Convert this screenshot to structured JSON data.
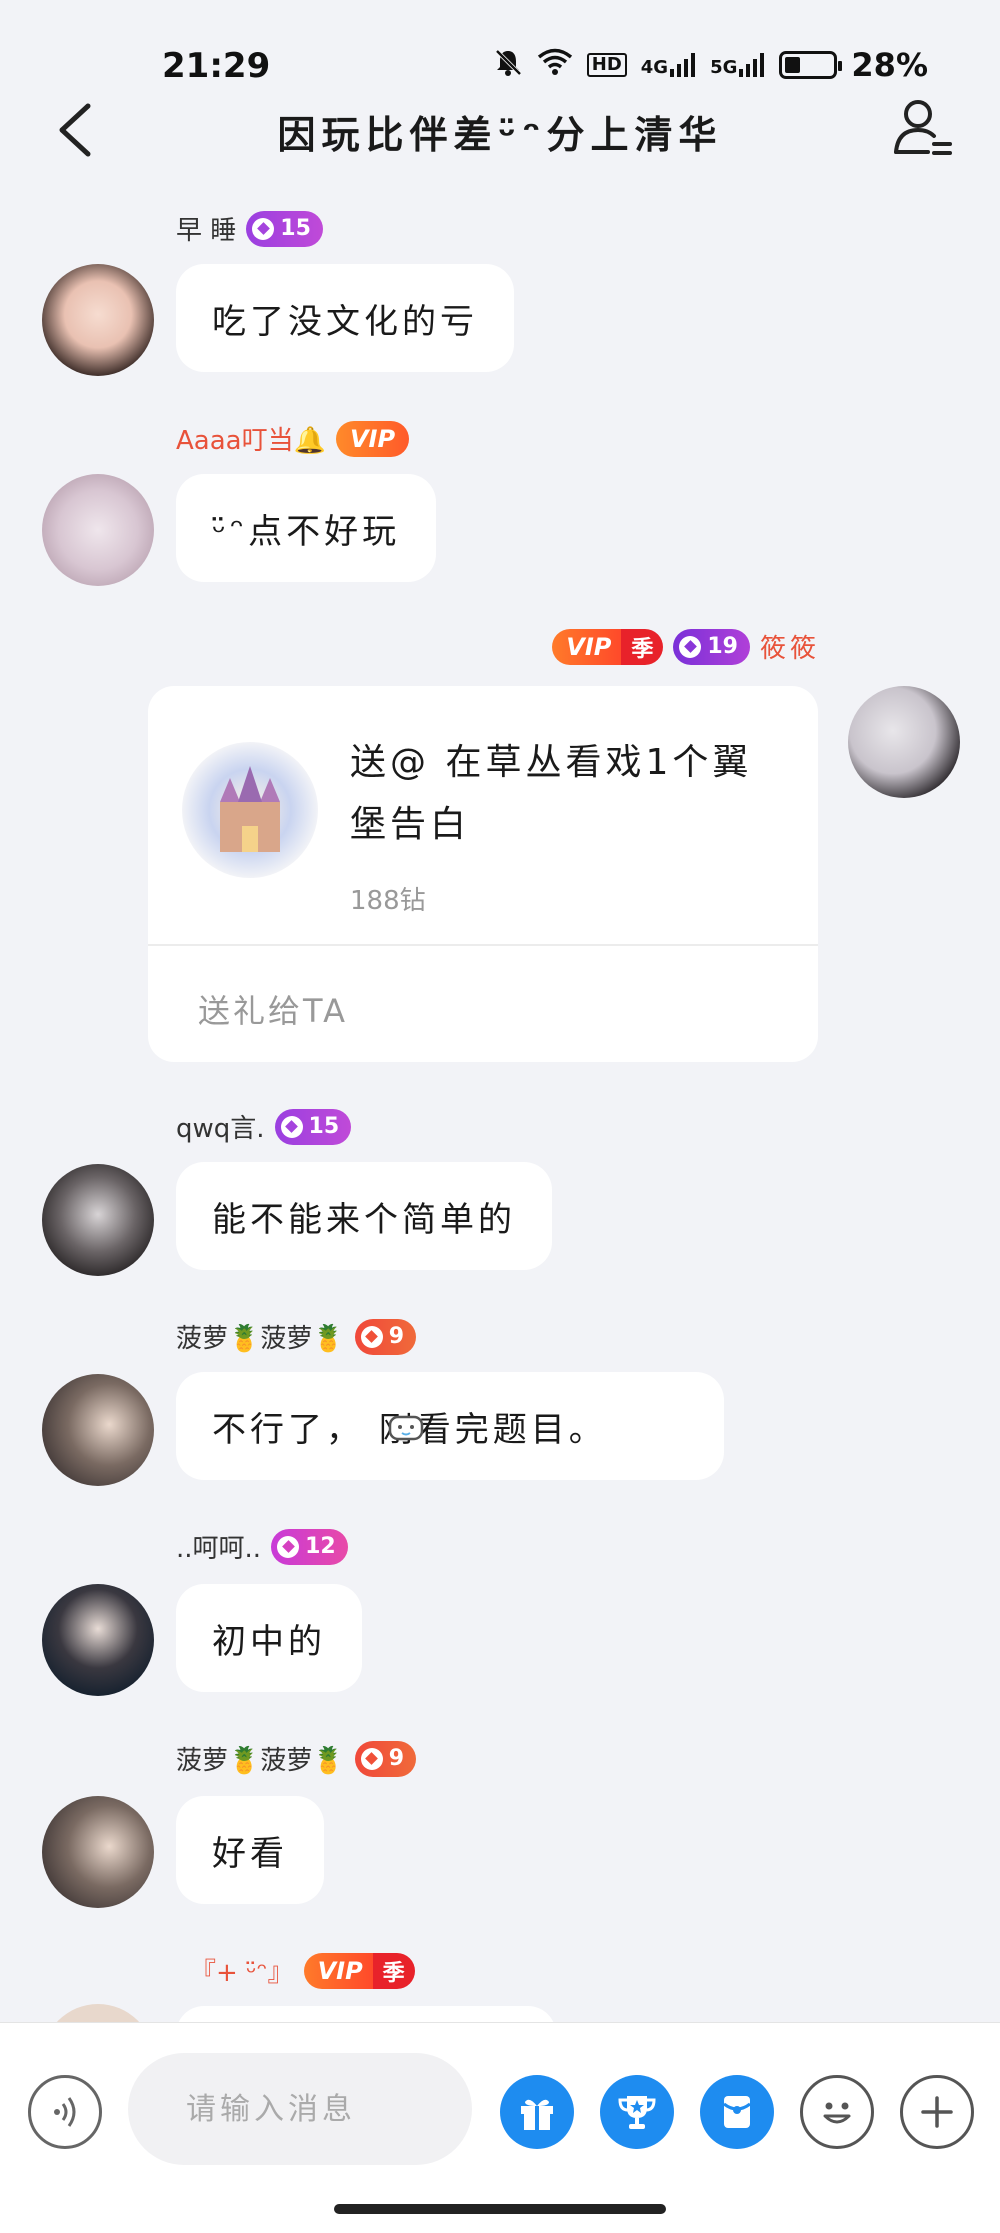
{
  "status_bar": {
    "time": "21:29",
    "network_hd": "HD",
    "network_4g": "4G",
    "network_5g": "5G",
    "battery_level": 0.28,
    "battery": "28%"
  },
  "header": {
    "title": "因玩比伴差ᵕ̈ᵔ分上清华"
  },
  "messages": [
    {
      "sender": "早 睡",
      "level": "15",
      "text": "吃了没文化的亏"
    },
    {
      "sender": "Aaaa叮当🔔",
      "badge": "VIP",
      "text": "ᵕ̈ᵔ点不好玩"
    },
    {
      "sender": "qwq言.",
      "level": "15",
      "text": "能不能来个简单的"
    },
    {
      "sender": "菠萝🍍菠萝🍍",
      "level": "9",
      "text": "不行了，   刚看完题目。"
    },
    {
      "sender": "..呵呵..",
      "level": "12",
      "text": "初中的"
    },
    {
      "sender": "菠萝🍍菠萝🍍",
      "level": "9",
      "text": "好看"
    },
    {
      "sender": "『+ ᵕ̈ᵔ』",
      "badge": "VIP"
    }
  ],
  "gift_message": {
    "sender": "筱筱",
    "level": "19",
    "vip_badge": "VIP",
    "season_badge": "季",
    "gift_text": "送@   在草丛看戏1个翼堡告白",
    "price": "188钻",
    "action": "送礼给TA"
  },
  "bottom_bar": {
    "input_placeholder": "请输入消息"
  },
  "colors": {
    "accent_blue": "#1e8cf0",
    "vip_orange": "#ff6a2a",
    "name_red": "#e8523a"
  }
}
